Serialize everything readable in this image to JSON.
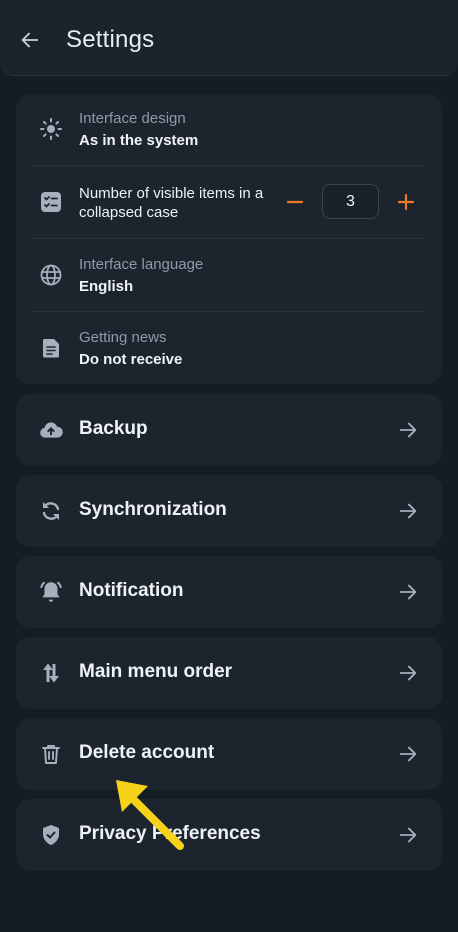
{
  "header": {
    "title": "Settings",
    "back_icon": "arrow-left-icon"
  },
  "settings": {
    "interface_design": {
      "label": "Interface design",
      "value": "As in the system",
      "icon": "sun-icon"
    },
    "visible_items": {
      "label": "Number of visible items in a collapsed case",
      "value": "3",
      "decrement_icon": "minus-icon",
      "increment_icon": "plus-icon",
      "icon": "checklist-icon"
    },
    "interface_language": {
      "label": "Interface language",
      "value": "English",
      "icon": "globe-icon"
    },
    "getting_news": {
      "label": "Getting news",
      "value": "Do not receive",
      "icon": "document-icon"
    }
  },
  "menu": [
    {
      "label": "Backup",
      "icon": "cloud-upload-icon"
    },
    {
      "label": "Synchronization",
      "icon": "sync-icon"
    },
    {
      "label": "Notification",
      "icon": "bell-icon"
    },
    {
      "label": "Main menu order",
      "icon": "reorder-icon"
    },
    {
      "label": "Delete account",
      "icon": "trash-icon"
    },
    {
      "label": "Privacy Preferences",
      "icon": "shield-check-icon"
    }
  ],
  "colors": {
    "background": "#141c24",
    "card": "#1c252d",
    "accent": "#f0782a",
    "annotation": "#f7d21b"
  }
}
